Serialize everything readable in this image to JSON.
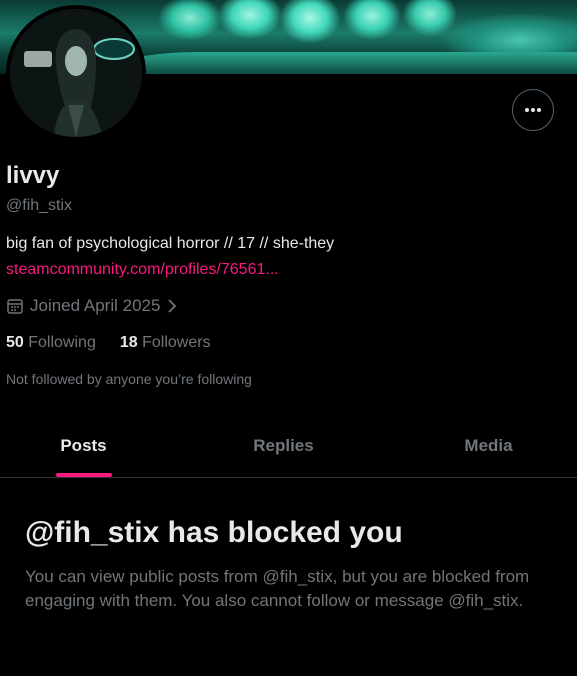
{
  "profile": {
    "name": "livvy",
    "handle": "@fih_stix",
    "bio": "big fan of psychological horror // 17 // she-they",
    "link": "steamcommunity.com/profiles/76561...",
    "joined": "Joined April 2025",
    "following_count": "50",
    "following_label": "Following",
    "followers_count": "18",
    "followers_label": "Followers",
    "not_followed": "Not followed by anyone you’re following"
  },
  "tabs": [
    {
      "label": "Posts",
      "active": true
    },
    {
      "label": "Replies",
      "active": false
    },
    {
      "label": "Media",
      "active": false
    }
  ],
  "blocked": {
    "title": "@fih_stix has blocked you",
    "body": "You can view public posts from @fih_stix, but you are blocked from engaging with them. You also cannot follow or message @fih_stix."
  },
  "icons": {
    "more": "more-horizontal-icon",
    "calendar": "calendar-icon",
    "chevron": "chevron-right-icon"
  },
  "colors": {
    "accent": "#f91880",
    "muted": "#71767b",
    "text": "#e7e9ea",
    "background": "#000000"
  }
}
